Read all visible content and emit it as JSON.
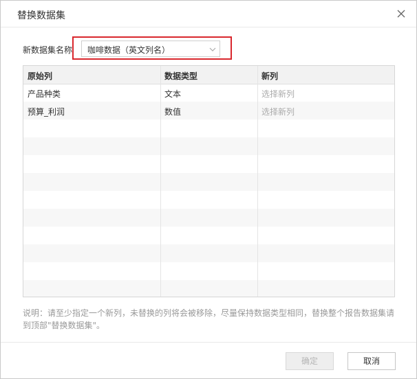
{
  "dialog": {
    "title": "替换数据集",
    "close_icon": "close-icon"
  },
  "dataset_field": {
    "label": "新数据集名称",
    "selected_value": "咖啡数据（英文列名）",
    "dropdown_icon": "chevron-down-icon",
    "highlight_color": "#d9262c"
  },
  "table": {
    "headers": {
      "original": "原始列",
      "type": "数据类型",
      "new": "新列"
    },
    "rows": [
      {
        "original": "产品种类",
        "type": "文本",
        "new_placeholder": "选择新列"
      },
      {
        "original": "预算_利润",
        "type": "数值",
        "new_placeholder": "选择新列"
      }
    ]
  },
  "note": "说明：请至少指定一个新列，未替换的列将会被移除，尽量保持数据类型相同，替换整个报告数据集请到顶部\"替换数据集\"。",
  "buttons": {
    "ok": "确定",
    "cancel": "取消"
  }
}
